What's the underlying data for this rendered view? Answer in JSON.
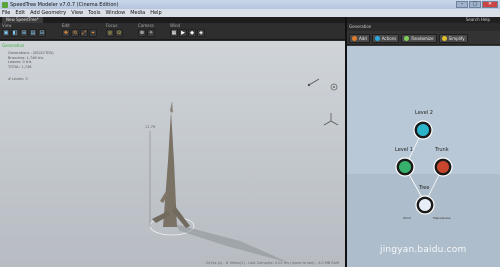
{
  "window": {
    "title": "SpeedTree Modeler v7.0.7 (Cinema Edition)",
    "controls": [
      "–",
      "□",
      "✕"
    ]
  },
  "menu": [
    "File",
    "Edit",
    "Add Geometry",
    "View",
    "Tools",
    "Window",
    "Media",
    "Help"
  ],
  "document_tab": "New SpeedTree*",
  "toolbar": {
    "groups": [
      {
        "label": "View",
        "buttons": [
          "▣",
          "◧",
          "⊞",
          "▤",
          "⊟"
        ]
      },
      {
        "label": "Edit",
        "buttons": [
          "✥",
          "⟲",
          "⤢",
          "⌖"
        ]
      },
      {
        "label": "Focus",
        "buttons": [
          "◎",
          "⊙"
        ]
      },
      {
        "label": "Camera",
        "buttons": [
          "⊚",
          "✧"
        ]
      },
      {
        "label": "Wind",
        "buttons": [
          "▦",
          "▶",
          "◆",
          "◈"
        ]
      }
    ]
  },
  "viewport": {
    "green_label": "Generation",
    "stats": [
      "Generations : (SELECTED)",
      "Branches: 1,748 tris",
      "Leaves: 0 tris",
      "TOTAL: 1,748"
    ],
    "lod": "# Levels: 3",
    "height_label": "11.7ft",
    "status": "24 fps (s) - # Views(1) - Last Compute: 0.02 ms (move to see) - 4.0 MB RAM"
  },
  "right_panel": {
    "top_right": "Search  Help",
    "header": "Generation",
    "buttons": [
      {
        "label": "Add",
        "icon_color": "#e07d2a"
      },
      {
        "label": "Actions",
        "icon_color": "#2aa9e0"
      },
      {
        "label": "Randomize",
        "icon_color": "#7fd05a"
      },
      {
        "label": "Simplify",
        "icon_color": "#e0c02a"
      }
    ],
    "nodes": [
      {
        "label": "Level 2",
        "color": "#2bb3c9"
      },
      {
        "label": "Level 1",
        "color": "#36b06a"
      },
      {
        "label": "Trunk",
        "color": "#c8452e"
      },
      {
        "label": "Tree",
        "color": "#e8eef5"
      }
    ],
    "node_sublabels": [
      "Wind",
      "Maps/Grass"
    ]
  },
  "watermark": "jingyan.baidu.com"
}
